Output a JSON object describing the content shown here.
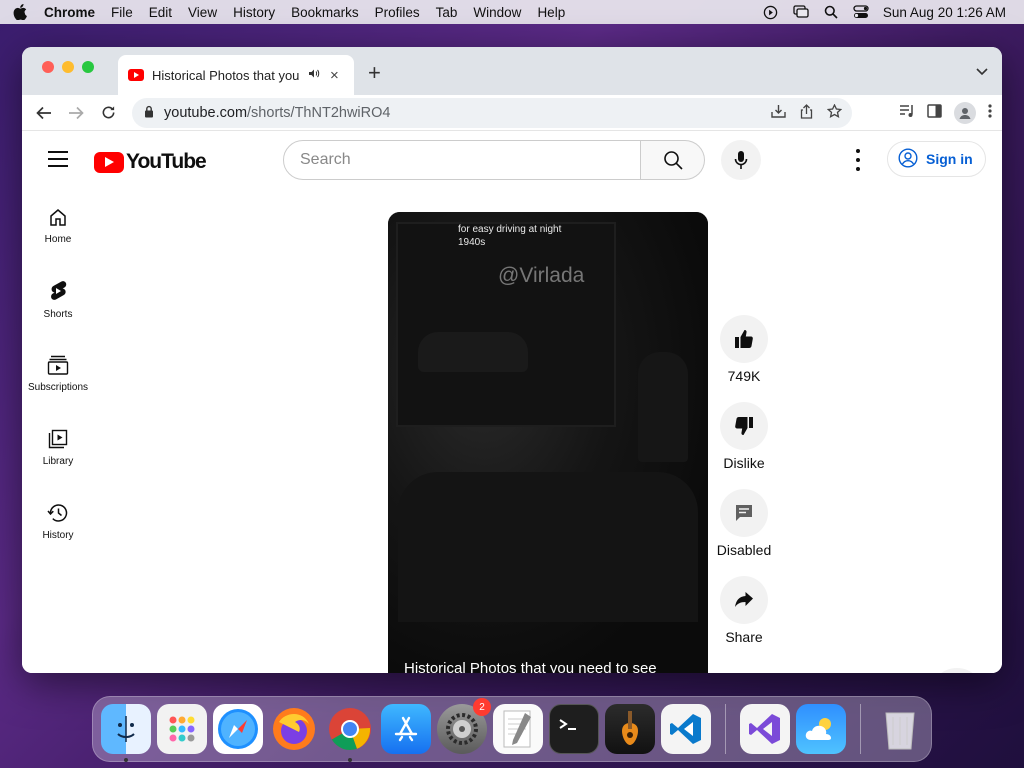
{
  "menubar": {
    "app_name": "Chrome",
    "items": [
      "File",
      "Edit",
      "View",
      "History",
      "Bookmarks",
      "Profiles",
      "Tab",
      "Window",
      "Help"
    ],
    "clock": "Sun Aug 20  1:26 AM"
  },
  "browser": {
    "tab_title": "Historical Photos that you need to see",
    "url_host": "youtube.com",
    "url_path": "/shorts/ThNT2hwiRO4"
  },
  "youtube": {
    "logo_text": "YouTube",
    "search_placeholder": "Search",
    "sign_in_label": "Sign in",
    "sidebar": [
      {
        "label": "Home",
        "icon": "home-icon"
      },
      {
        "label": "Shorts",
        "icon": "shorts-icon"
      },
      {
        "label": "Subscriptions",
        "icon": "subscriptions-icon"
      },
      {
        "label": "Library",
        "icon": "library-icon"
      },
      {
        "label": "History",
        "icon": "history-icon"
      }
    ],
    "short": {
      "caption_line1": "for easy driving at night",
      "caption_line2": "1940s",
      "watermark": "@Virlada",
      "title": "Historical Photos that you need to see"
    },
    "actions": {
      "like_count": "749K",
      "dislike_label": "Dislike",
      "comments_label": "Disabled",
      "share_label": "Share"
    }
  },
  "dock": {
    "apps": [
      "Finder",
      "Launchpad",
      "Safari",
      "Firefox",
      "Chrome",
      "App Store",
      "System Settings",
      "TextEdit",
      "Terminal",
      "GarageBand",
      "Visual Studio Code",
      "Visual Studio",
      "Weather",
      "Trash"
    ],
    "settings_badge": "2"
  },
  "colors": {
    "youtube_red": "#ff0000",
    "link_blue": "#065fd4"
  }
}
